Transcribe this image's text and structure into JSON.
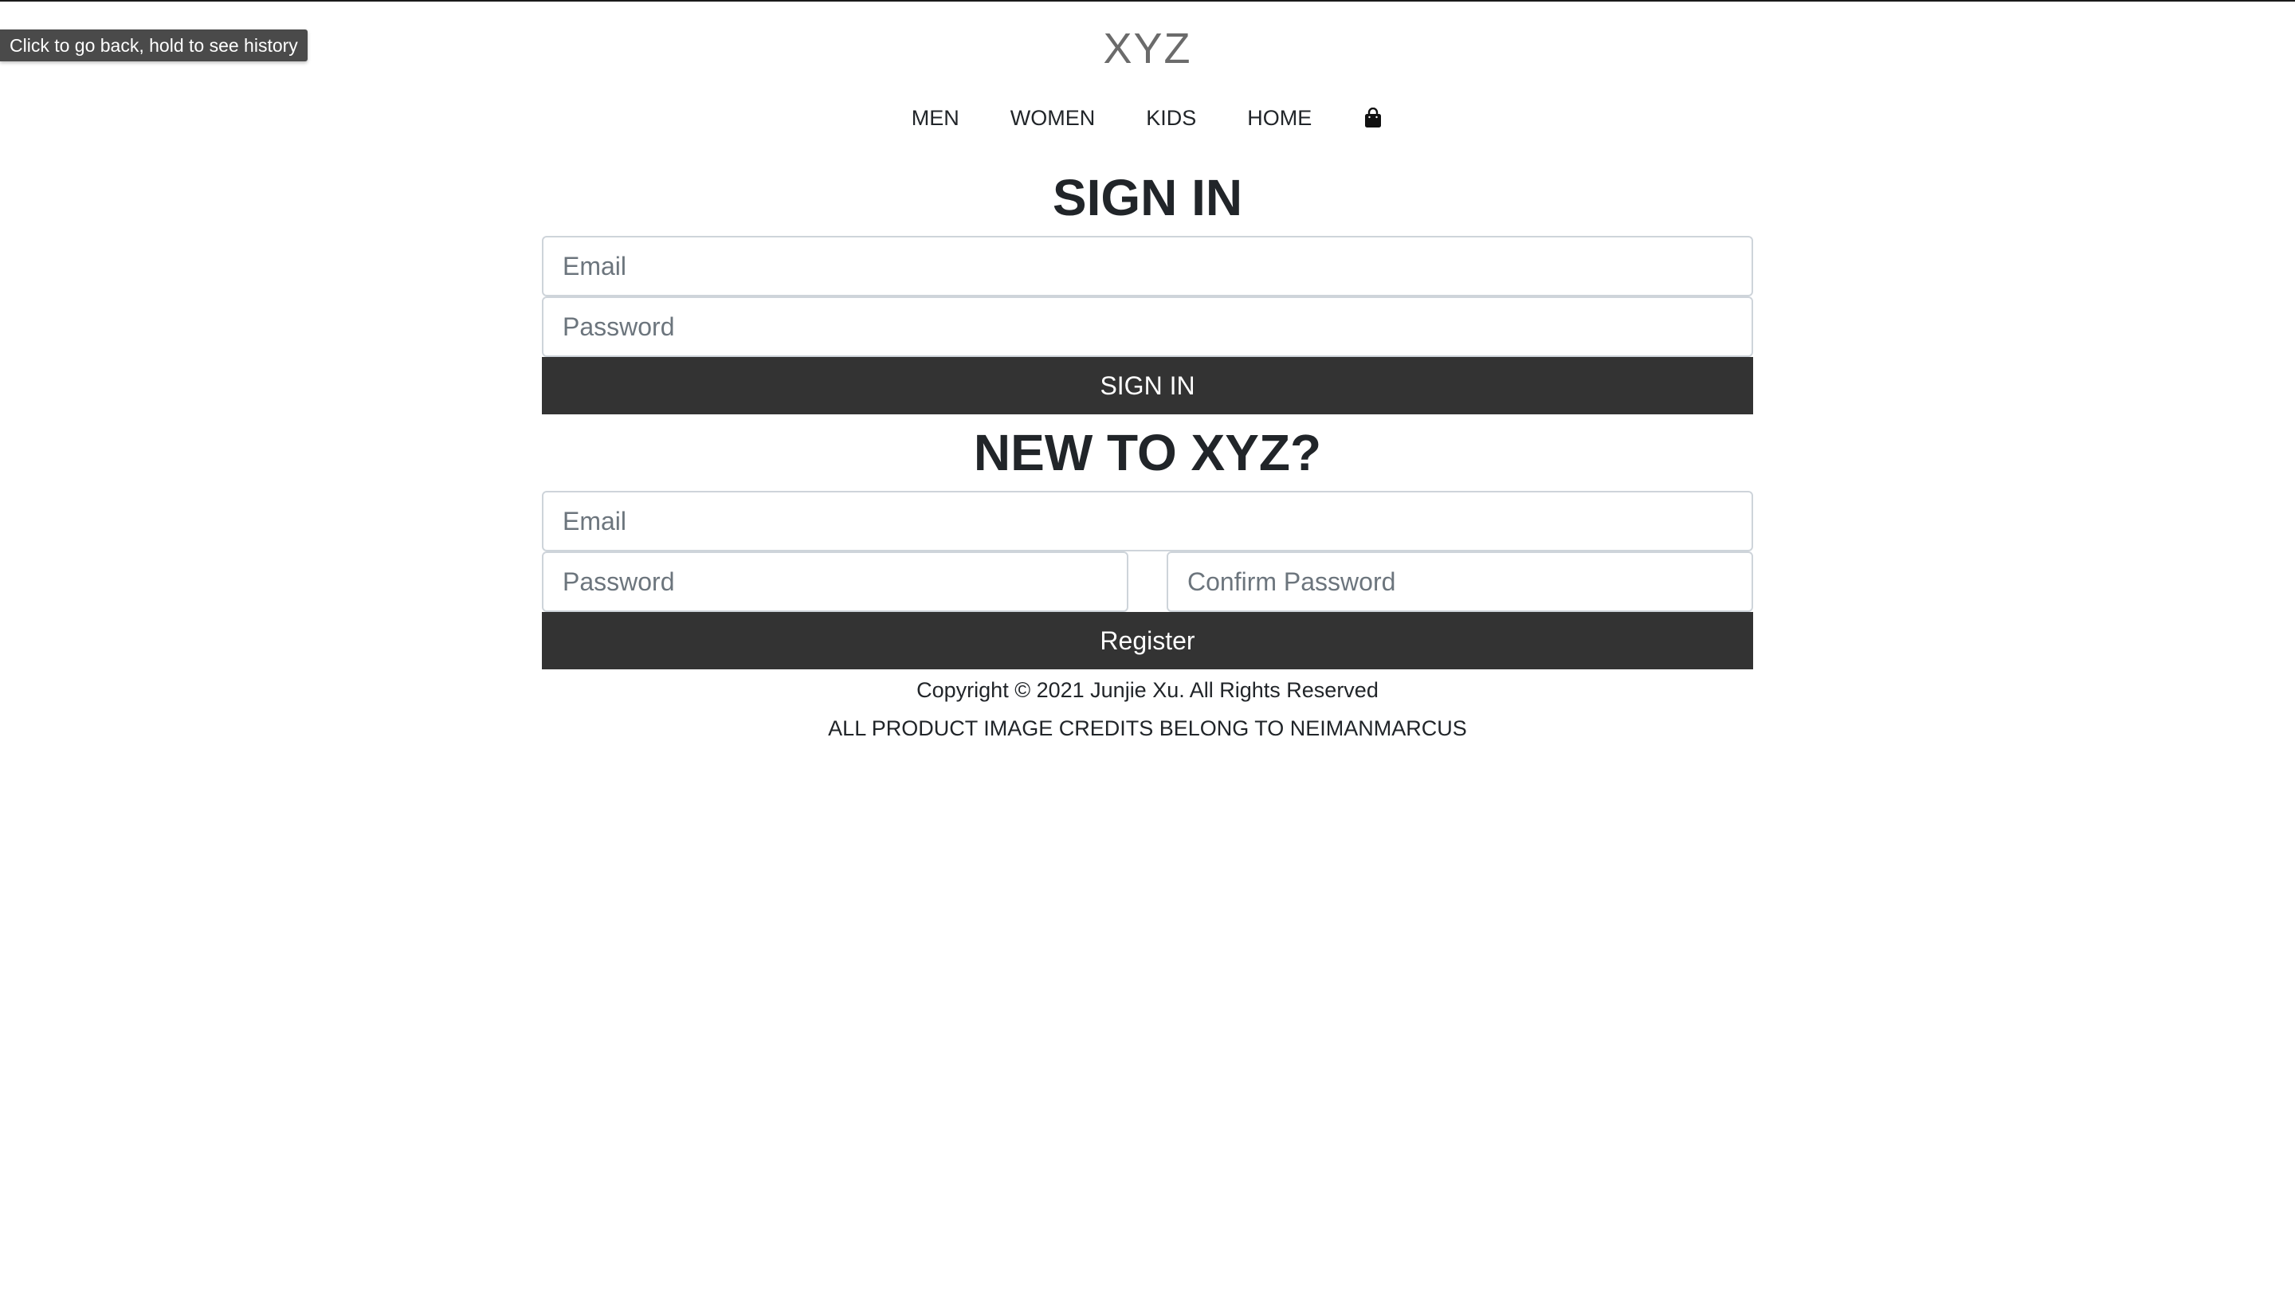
{
  "browser": {
    "back_tooltip": "Click to go back, hold to see history"
  },
  "header": {
    "brand": "XYZ",
    "nav": [
      {
        "label": "MEN"
      },
      {
        "label": "WOMEN"
      },
      {
        "label": "KIDS"
      },
      {
        "label": "HOME"
      }
    ],
    "cart_icon": "shopping-bag-icon"
  },
  "sign_in": {
    "title": "SIGN IN",
    "email_placeholder": "Email",
    "email_value": "",
    "password_placeholder": "Password",
    "password_value": "",
    "button_label": "SIGN IN"
  },
  "register": {
    "title": "NEW TO XYZ?",
    "email_placeholder": "Email",
    "email_value": "",
    "password_placeholder": "Password",
    "password_value": "",
    "confirm_placeholder": "Confirm Password",
    "confirm_value": "",
    "button_label": "Register"
  },
  "footer": {
    "copyright": "Copyright © 2021 Junjie Xu. All Rights Reserved",
    "credits": "ALL PRODUCT IMAGE CREDITS BELONG TO NEIMANMARCUS"
  },
  "colors": {
    "button_bg": "#333333",
    "brand": "#6b6b6b",
    "input_border": "#ced4da"
  }
}
